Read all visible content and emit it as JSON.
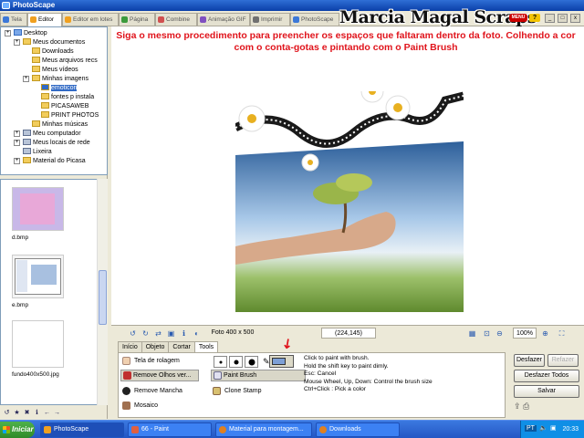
{
  "window": {
    "title": "PhotoScape",
    "min": "_",
    "max": "□",
    "close": "x"
  },
  "tabs": [
    {
      "label": "Tela",
      "color": "#3c78d8"
    },
    {
      "label": "Editor",
      "color": "#f0a020"
    },
    {
      "label": "Editor em lotes",
      "color": "#f0a020"
    },
    {
      "label": "Página",
      "color": "#3c9a3c"
    },
    {
      "label": "Combine",
      "color": "#d05050"
    },
    {
      "label": "Animação GIF",
      "color": "#8050c0"
    },
    {
      "label": "Imprimir",
      "color": "#707070"
    },
    {
      "label": "PhotoScape",
      "color": "#3c78d8"
    }
  ],
  "brand": "Marcia Magal Scraps",
  "header": {
    "menu_badge": "MENU",
    "help_badge": "?"
  },
  "tree": [
    {
      "label": "Desktop",
      "icon": "blue"
    },
    {
      "label": "Meus documentos",
      "icon": "yellow"
    },
    {
      "label": "Downloads",
      "icon": "yellow"
    },
    {
      "label": "Meus arquivos recs",
      "icon": "yellow"
    },
    {
      "label": "Meus vídeos",
      "icon": "yellow"
    },
    {
      "label": "Minhas imagens",
      "icon": "yellow"
    },
    {
      "label": "emoticon",
      "icon": "yellow"
    },
    {
      "label": "fontes p instala",
      "icon": "yellow"
    },
    {
      "label": "PICASAWEB",
      "icon": "yellow"
    },
    {
      "label": "PRINT PHOTOS",
      "icon": "yellow"
    },
    {
      "label": "Minhas músicas",
      "icon": "yellow"
    },
    {
      "label": "Meu computador",
      "icon": "gray"
    },
    {
      "label": "Meus locais de rede",
      "icon": "gray"
    },
    {
      "label": "Lixeira",
      "icon": "gray"
    },
    {
      "label": "Material do Picasa",
      "icon": "yellow"
    }
  ],
  "thumbnails": [
    {
      "label": "d.bmp"
    },
    {
      "label": "e.bmp"
    },
    {
      "label": "fundo400x500.jpg"
    }
  ],
  "instruction": "Siga o mesmo procedimento para preencher os espaços que faltaram dentro da foto. Colhendo a cor com o conta-gotas e pintando com o Paint Brush",
  "status": {
    "photo_size": "Foto 400 x 500",
    "coords": "(224,145)",
    "zoom": "100%",
    "zoom_value": 100
  },
  "bottom_tabs": [
    "Início",
    "Objeto",
    "Cortar",
    "Tools"
  ],
  "tools": {
    "red_eye_brush": "Tela de rolagem",
    "remove_red_eye": "Remove Olhos ver...",
    "remove_spot": "Remove Mancha",
    "mosaic": "Mosaico",
    "paint_brush": "Paint Brush",
    "clone_stamp": "Clone Stamp"
  },
  "brush_color": "#7d9fd6",
  "instructions_lines": [
    "Click to paint with brush.",
    "Hold the shift key to paint dimly.",
    "Esc: Cancel",
    "Mouse Wheel, Up, Down: Control the brush size",
    "Ctrl+Click : Pick a color"
  ],
  "actions": {
    "undo": "Desfazer",
    "redo": "Refazer",
    "undo_all": "Desfazer Todos",
    "save": "Salvar"
  },
  "taskbar": {
    "start": "Iniciar",
    "items": [
      "PhotoScape",
      "66 - Paint",
      "Material para montagem...",
      "Downloads"
    ],
    "lang": "PT",
    "clock": "20:33"
  }
}
